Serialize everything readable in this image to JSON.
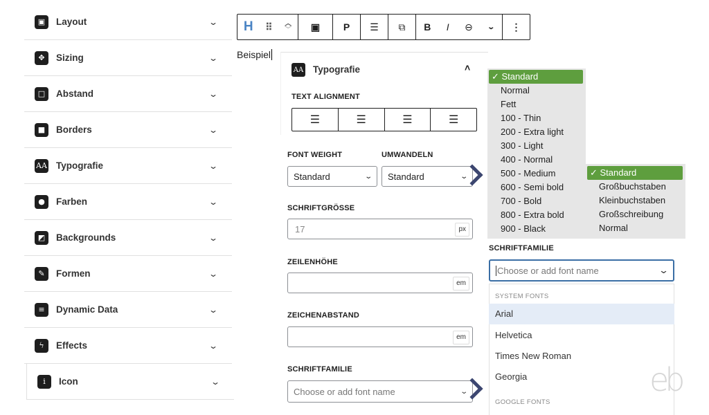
{
  "sidebar": {
    "items": [
      {
        "label": "Layout",
        "icon": "layout-icon"
      },
      {
        "label": "Sizing",
        "icon": "sizing-icon"
      },
      {
        "label": "Abstand",
        "icon": "spacing-icon"
      },
      {
        "label": "Borders",
        "icon": "borders-icon"
      },
      {
        "label": "Typografie",
        "icon": "typography-icon"
      },
      {
        "label": "Farben",
        "icon": "palette-icon"
      },
      {
        "label": "Backgrounds",
        "icon": "backgrounds-icon"
      },
      {
        "label": "Formen",
        "icon": "shapes-icon"
      },
      {
        "label": "Dynamic Data",
        "icon": "database-icon"
      },
      {
        "label": "Effects",
        "icon": "effects-icon"
      },
      {
        "label": "Icon",
        "icon": "info-icon"
      }
    ]
  },
  "toolbar": {
    "paragraph": "P",
    "bold": "B",
    "italic": "I"
  },
  "editor": {
    "text": "Beispiel"
  },
  "typography": {
    "title": "Typografie",
    "text_alignment": "TEXT ALIGNMENT",
    "font_weight_label": "FONT WEIGHT",
    "font_weight_value": "Standard",
    "transform_label": "UMWANDELN",
    "transform_value": "Standard",
    "font_size_label": "SCHRIFTGRÖSSE",
    "font_size_value": "17",
    "font_size_unit": "px",
    "line_height_label": "ZEILENHÖHE",
    "line_height_unit": "em",
    "letter_spacing_label": "ZEICHENABSTAND",
    "letter_spacing_unit": "em",
    "font_family_label": "SCHRIFTFAMILIE",
    "font_family_placeholder": "Choose or add font name"
  },
  "weight_dropdown": {
    "selected": "✓ Standard",
    "options": [
      "Normal",
      "Fett",
      "100 - Thin",
      "200 - Extra light",
      "300 - Light",
      "400 - Normal",
      "500 - Medium",
      "600 - Semi bold",
      "700 - Bold",
      "800 - Extra bold",
      "900 - Black"
    ]
  },
  "transform_dropdown": {
    "selected": "✓ Standard",
    "options": [
      "Großbuchstaben",
      "Kleinbuchstaben",
      "Großschreibung",
      "Normal"
    ]
  },
  "font_family_popup": {
    "label": "SCHRIFTFAMILIE",
    "placeholder": "Choose or add font name",
    "system_heading": "SYSTEM FONTS",
    "fonts": [
      "Arial",
      "Helvetica",
      "Times New Roman",
      "Georgia"
    ],
    "google_heading": "GOOGLE FONTS"
  },
  "logo": "eb",
  "colors": {
    "selected_green": "#5e9e3e",
    "arrow": "#3c4670",
    "focus_blue": "#3a6ea5",
    "highlight": "#e4ecf7"
  }
}
